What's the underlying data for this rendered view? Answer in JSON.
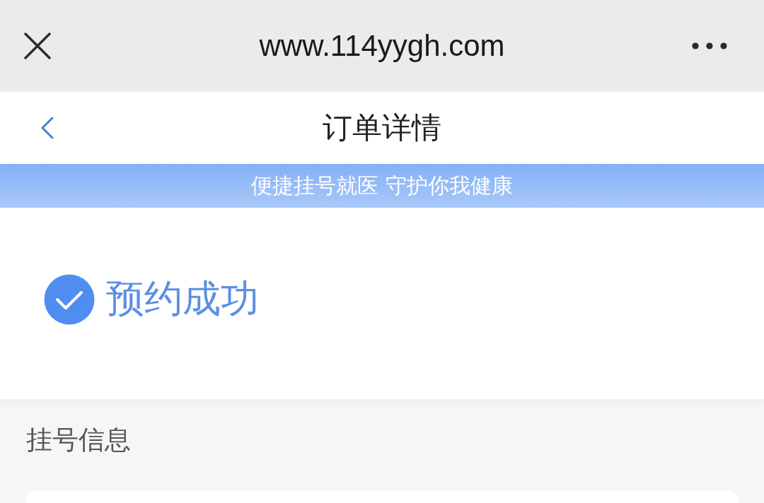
{
  "browser_bar": {
    "url": "www.114yygh.com"
  },
  "header": {
    "title": "订单详情"
  },
  "banner": {
    "text": "便捷挂号就医 守护你我健康"
  },
  "status": {
    "text": "预约成功"
  },
  "section": {
    "title": "挂号信息"
  }
}
